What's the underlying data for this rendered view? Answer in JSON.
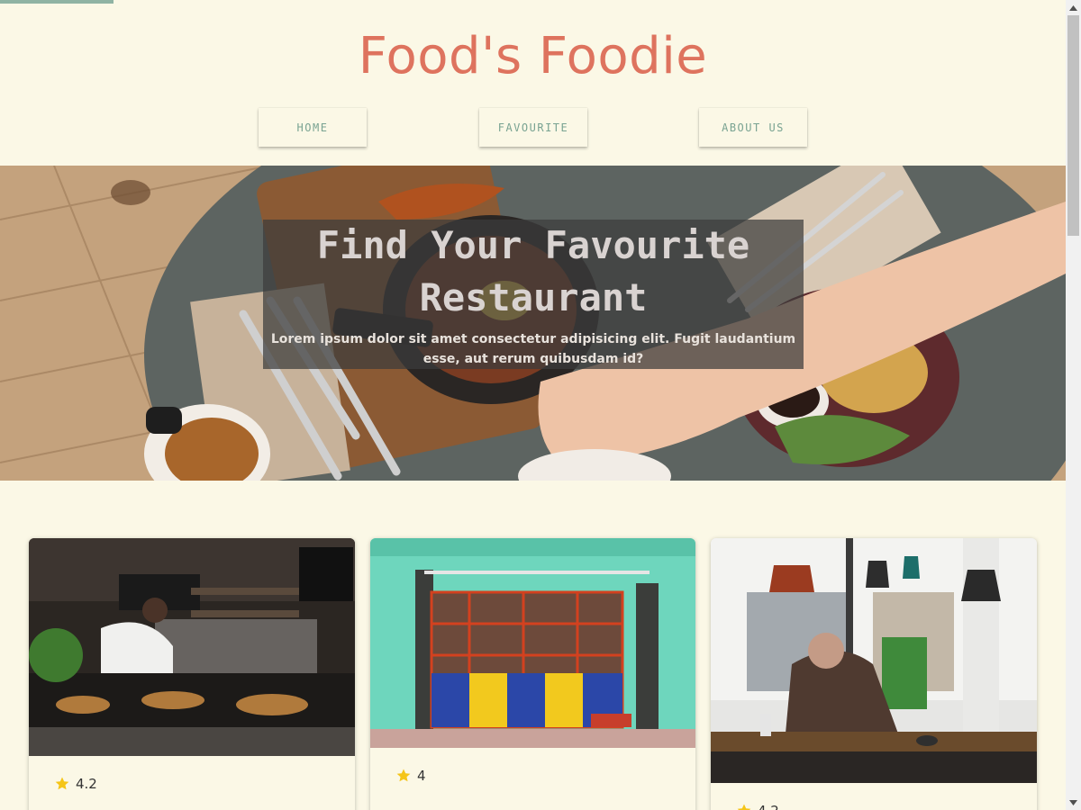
{
  "header": {
    "title": "Food's Foodie"
  },
  "nav": {
    "home": "HOME",
    "favourite": "FAVOURITE",
    "about": "ABOUT US"
  },
  "hero": {
    "title": "Find Your Favourite Restaurant",
    "subtitle": "Lorem ipsum dolor sit amet consectetur adipisicing elit. Fugit laudantium esse, aut rerum quibusdam id?"
  },
  "cards": [
    {
      "rating": "4.2",
      "image": "restaurant-counter-photo"
    },
    {
      "rating": "4",
      "image": "colorful-storefront-photo"
    },
    {
      "rating": "4.2",
      "image": "cafe-interior-photo"
    }
  ],
  "colors": {
    "background": "#fbf8e6",
    "title": "#de735e",
    "nav_text": "#79a392",
    "star": "#f5c518"
  }
}
